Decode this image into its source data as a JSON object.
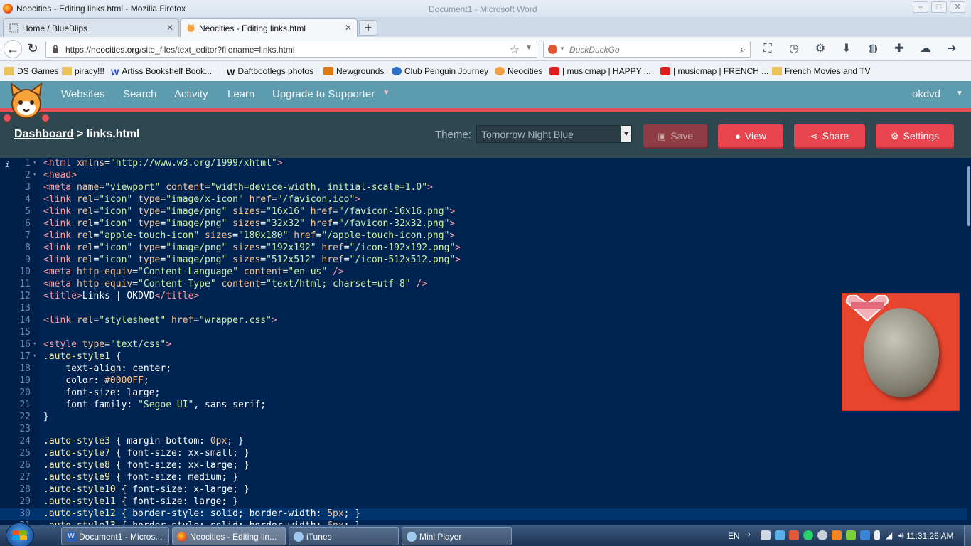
{
  "window": {
    "title": "Neocities - Editing links.html - Mozilla Firefox",
    "background_window_title": "Document1 - Microsoft Word"
  },
  "tabs": [
    {
      "label": "Home / BlueBlips",
      "active": false
    },
    {
      "label": "Neocities - Editing links.html",
      "active": true
    }
  ],
  "navbar": {
    "url_prefix": "https://",
    "url_host": "neocities.org",
    "url_path": "/site_files/text_editor?filename=links.html",
    "search_placeholder": "DuckDuckGo"
  },
  "bookmarks": [
    "DS Games",
    "piracy!!!",
    "Artiss Bookshelf Book...",
    "Daftbootlegs photos",
    "Newgrounds",
    "Club Penguin Journey",
    "Neocities",
    "| musicmap | HAPPY ...",
    "| musicmap | FRENCH ...",
    "French Movies and TV"
  ],
  "neocities_nav": {
    "links": [
      "Websites",
      "Search",
      "Activity",
      "Learn",
      "Upgrade to Supporter"
    ],
    "user": "okdvd"
  },
  "editor_header": {
    "breadcrumb_root": "Dashboard",
    "breadcrumb_sep": " > ",
    "breadcrumb_file": "links.html",
    "theme_label": "Theme:",
    "theme_value": "Tomorrow Night Blue",
    "save_label": "Save",
    "view_label": "View",
    "share_label": "Share",
    "settings_label": "Settings"
  },
  "editor": {
    "active_line": 30
  },
  "taskbar": {
    "tasks": [
      "Document1 - Micros...",
      "Neocities - Editing lin...",
      "iTunes",
      "Mini Player"
    ],
    "lang": "EN",
    "time": "11:31:26 AM"
  },
  "colors": {
    "editor_bg": "#002451",
    "neocities_teal": "#5d9cae",
    "neocities_red": "#e94e5b",
    "header_bg": "#2f4751"
  }
}
